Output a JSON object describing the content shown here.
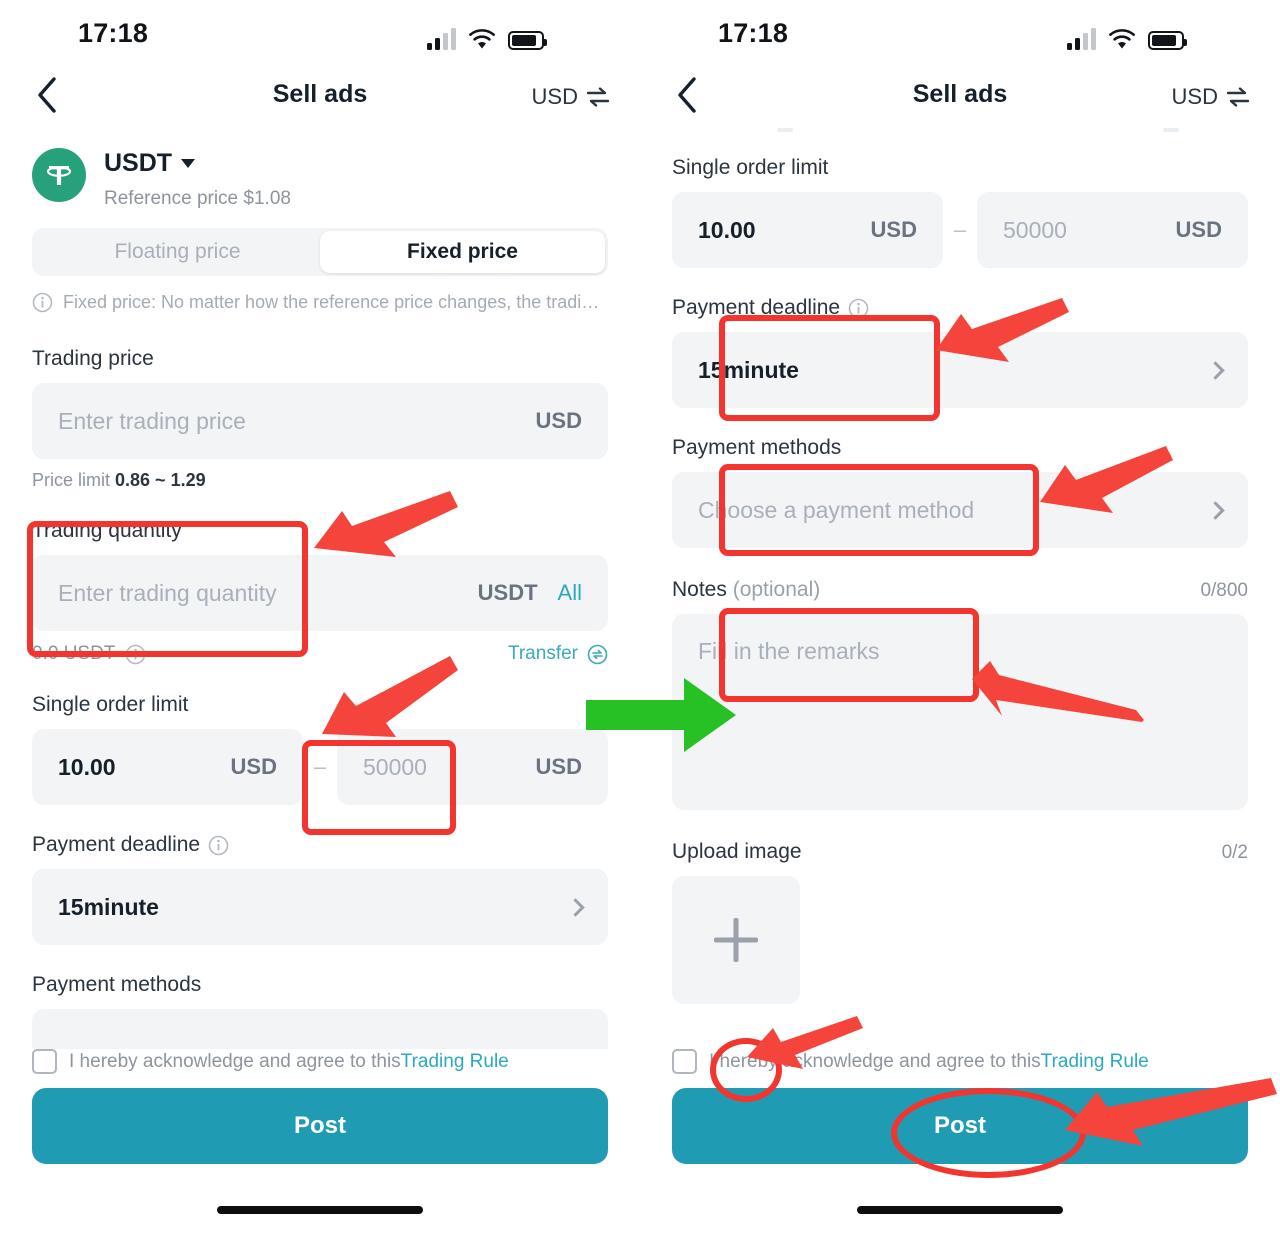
{
  "meta": {
    "accent_teal": "#1f9bb3",
    "accent_link": "#2aa9c0",
    "usdt_green": "#26a17b",
    "annotation_red": "#f2362f",
    "annotation_green": "#27c125"
  },
  "status_bar": {
    "time": "17:18"
  },
  "nav": {
    "back_label": "Back",
    "title": "Sell ads",
    "currency": "USD"
  },
  "left_screen": {
    "coin": {
      "symbol": "USDT",
      "reference_price": "Reference price $1.08"
    },
    "price_mode": {
      "floating": "Floating price",
      "fixed": "Fixed price",
      "selected": "Fixed price"
    },
    "fixed_price_hint": "Fixed price: No matter how the reference price changes, the tradi…",
    "trading_price": {
      "label": "Trading price",
      "placeholder": "Enter trading price",
      "value": "",
      "unit": "USD"
    },
    "price_limit": {
      "prefix": "Price limit ",
      "range": "0.86 ~ 1.29"
    },
    "trading_quantity": {
      "label": "Trading quantity",
      "placeholder": "Enter trading quantity",
      "value": "",
      "unit": "USDT",
      "all_label": "All"
    },
    "balance": "0.0 USDT",
    "transfer_label": "Transfer",
    "single_order_limit": {
      "label": "Single order limit",
      "min_value": "10.00",
      "min_unit": "USD",
      "separator": "–",
      "max_placeholder": "50000",
      "max_unit": "USD"
    },
    "payment_deadline": {
      "label": "Payment deadline",
      "value": "15minute"
    },
    "payment_methods": {
      "label": "Payment methods"
    },
    "agree": {
      "text": "I hereby acknowledge and agree to this",
      "link": "Trading Rule",
      "checked": false
    },
    "post_button": "Post"
  },
  "right_screen": {
    "single_order_limit": {
      "label": "Single order limit",
      "min_value": "10.00",
      "min_unit": "USD",
      "separator": "–",
      "max_placeholder": "50000",
      "max_unit": "USD"
    },
    "payment_deadline": {
      "label": "Payment deadline",
      "value": "15minute"
    },
    "payment_methods": {
      "label": "Payment methods",
      "placeholder": "Choose a payment method"
    },
    "notes": {
      "label": "Notes ",
      "optional": "(optional)",
      "counter": "0/800",
      "placeholder": "Fill in the remarks"
    },
    "upload_image": {
      "label": "Upload image",
      "counter": "0/2"
    },
    "agree": {
      "text": "I hereby acknowledge and agree to this",
      "link": "Trading Rule",
      "checked": false
    },
    "post_button": "Post"
  },
  "annotations": {
    "items": [
      {
        "name": "highlight-trading-quantity",
        "shape": "rect"
      },
      {
        "name": "arrow-to-trading-quantity",
        "shape": "arrow",
        "color": "red"
      },
      {
        "name": "highlight-max-order-limit",
        "shape": "rect"
      },
      {
        "name": "arrow-to-max-order-limit",
        "shape": "arrow",
        "color": "red"
      },
      {
        "name": "arrow-between-screens",
        "shape": "arrow",
        "color": "green"
      },
      {
        "name": "highlight-payment-deadline",
        "shape": "rect"
      },
      {
        "name": "arrow-to-payment-deadline",
        "shape": "arrow",
        "color": "red"
      },
      {
        "name": "highlight-payment-methods",
        "shape": "rect"
      },
      {
        "name": "arrow-to-payment-methods",
        "shape": "arrow",
        "color": "red"
      },
      {
        "name": "highlight-notes",
        "shape": "rect"
      },
      {
        "name": "arrow-to-notes",
        "shape": "arrow",
        "color": "red"
      },
      {
        "name": "highlight-agree-checkbox",
        "shape": "ellipse"
      },
      {
        "name": "arrow-to-agree-checkbox",
        "shape": "arrow",
        "color": "red"
      },
      {
        "name": "highlight-post-button",
        "shape": "ellipse"
      },
      {
        "name": "arrow-to-post-button",
        "shape": "arrow",
        "color": "red"
      }
    ]
  }
}
